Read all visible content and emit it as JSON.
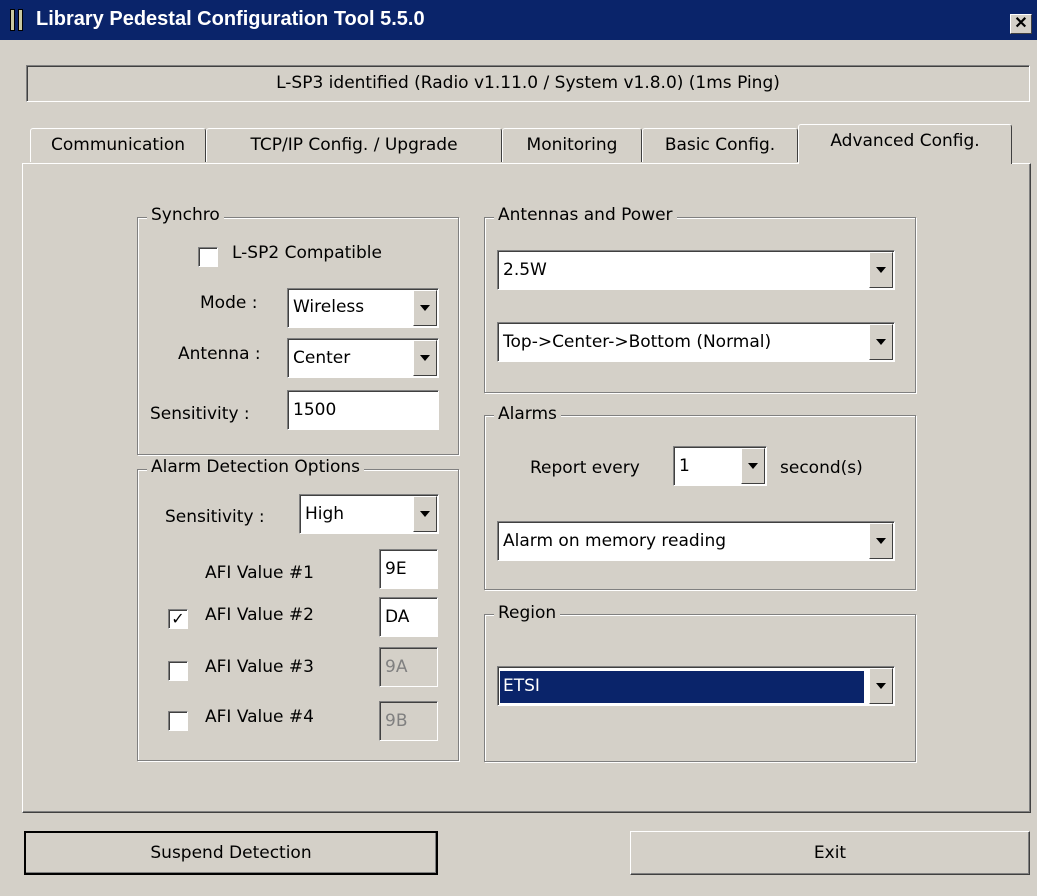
{
  "window": {
    "title": "Library Pedestal Configuration Tool 5.5.0",
    "close_glyph": "✕"
  },
  "status": "L-SP3 identified (Radio v1.11.0 / System v1.8.0) (1ms Ping)",
  "tabs": [
    {
      "label": "Communication"
    },
    {
      "label": "TCP/IP Config. / Upgrade"
    },
    {
      "label": "Monitoring"
    },
    {
      "label": "Basic Config."
    },
    {
      "label": "Advanced Config."
    }
  ],
  "active_tab": "Advanced Config.",
  "synchro": {
    "title": "Synchro",
    "compat_label": "L-SP2 Compatible",
    "compat_checked": false,
    "mode_label": "Mode :",
    "mode_value": "Wireless",
    "antenna_label": "Antenna :",
    "antenna_value": "Center",
    "sensitivity_label": "Sensitivity :",
    "sensitivity_value": "1500"
  },
  "alarm_detection": {
    "title": "Alarm Detection Options",
    "sensitivity_label": "Sensitivity :",
    "sensitivity_value": "High",
    "afi": [
      {
        "label": "AFI Value #1",
        "value": "9E",
        "checked": null,
        "enabled": true
      },
      {
        "label": "AFI Value #2",
        "value": "DA",
        "checked": true,
        "enabled": true,
        "check_glyph": "✓"
      },
      {
        "label": "AFI Value #3",
        "value": "9A",
        "checked": false,
        "enabled": false
      },
      {
        "label": "AFI Value #4",
        "value": "9B",
        "checked": false,
        "enabled": false
      }
    ]
  },
  "antennas_power": {
    "title": "Antennas and Power",
    "power_value": "2.5W",
    "sequence_value": "Top->Center->Bottom (Normal)"
  },
  "alarms": {
    "title": "Alarms",
    "report_label": "Report every",
    "report_value": "1",
    "unit_label": "second(s)",
    "mode_value": "Alarm on  memory reading"
  },
  "region": {
    "title": "Region",
    "value": "ETSI",
    "selected_bg": "#0a246a"
  },
  "buttons": {
    "suspend": "Suspend Detection",
    "exit": "Exit"
  }
}
